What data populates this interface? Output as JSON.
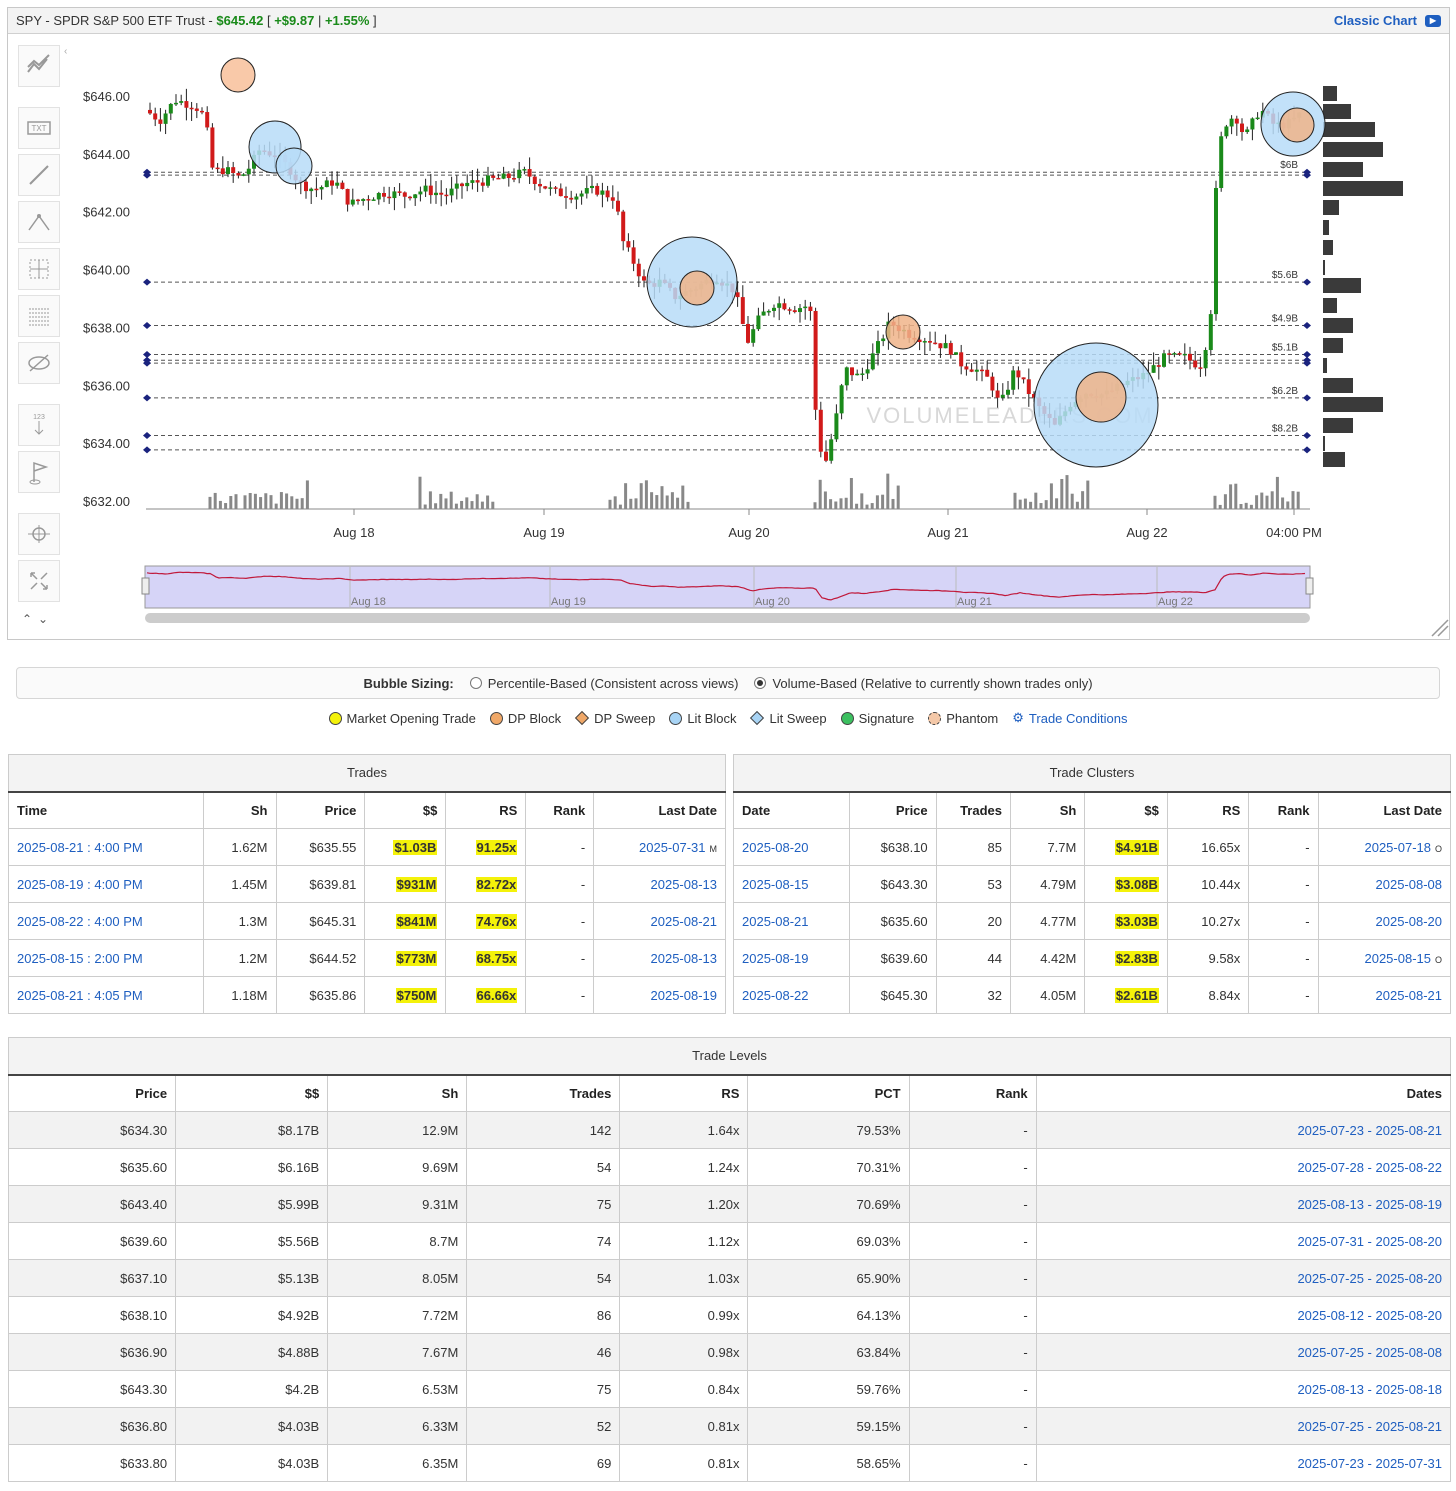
{
  "header": {
    "ticker": "SPY - SPDR S&P 500 ETF Trust - ",
    "price": "$645.42",
    "change_open": " [ ",
    "change": "+$9.87",
    "sep": " | ",
    "pct": "+1.55%",
    "close": " ]",
    "classic_chart": "Classic Chart"
  },
  "toolbar": [
    "trend-icon",
    "text-icon",
    "line-icon",
    "fib-icon",
    "crosshair-box-icon",
    "grid-lines-icon",
    "hide-icon",
    "measure-icon",
    "flag-icon",
    "target-icon",
    "expand-icon"
  ],
  "chart_data": {
    "type": "candlestick",
    "y_ticks": [
      "$646.00",
      "$644.00",
      "$642.00",
      "$640.00",
      "$638.00",
      "$636.00",
      "$634.00",
      "$632.00"
    ],
    "x_ticks": [
      "Aug 18",
      "Aug 19",
      "Aug 20",
      "Aug 21",
      "Aug 22",
      "04:00 PM"
    ],
    "navigator_ticks": [
      "Aug 18",
      "Aug 19",
      "Aug 20",
      "Aug 21",
      "Aug 22"
    ],
    "ylim": [
      632,
      647
    ],
    "levels": [
      {
        "price": 643.4,
        "label": "$6B"
      },
      {
        "price": 643.3,
        "label": ""
      },
      {
        "price": 639.6,
        "label": "$5.6B"
      },
      {
        "price": 638.1,
        "label": "$4.9B"
      },
      {
        "price": 637.1,
        "label": "$5.1B"
      },
      {
        "price": 636.9,
        "label": ""
      },
      {
        "price": 636.8,
        "label": ""
      },
      {
        "price": 635.6,
        "label": "$6.2B"
      },
      {
        "price": 634.3,
        "label": "$8.2B"
      },
      {
        "price": 633.8,
        "label": ""
      }
    ],
    "watermark": "VOLUMELEADERS.COM"
  },
  "bubble_sizing": {
    "label": "Bubble Sizing:",
    "opt1": "Percentile-Based (Consistent across views)",
    "opt2": "Volume-Based (Relative to currently shown trades only)"
  },
  "legend": {
    "l1": "Market Opening Trade",
    "l2": "DP Block",
    "l3": "DP Sweep",
    "l4": "Lit Block",
    "l5": "Lit Sweep",
    "l6": "Signature",
    "l7": "Phantom",
    "l8": "Trade Conditions",
    "c1": "#f4f20a",
    "c2": "#f0a868",
    "c3": "#f0a868",
    "c4": "#a8d4f5",
    "c5": "#a8d4f5",
    "c6": "#3cc060",
    "c7": "#f4c8a8"
  },
  "trades": {
    "title": "Trades",
    "headers": [
      "Time",
      "Sh",
      "Price",
      "$$",
      "RS",
      "Rank",
      "Last Date"
    ],
    "rows": [
      [
        "2025-08-21 : 4:00 PM",
        "1.62M",
        "$635.55",
        "$1.03B",
        "91.25x",
        "-",
        "2025-07-31",
        "M"
      ],
      [
        "2025-08-19 : 4:00 PM",
        "1.45M",
        "$639.81",
        "$931M",
        "82.72x",
        "-",
        "2025-08-13",
        ""
      ],
      [
        "2025-08-22 : 4:00 PM",
        "1.3M",
        "$645.31",
        "$841M",
        "74.76x",
        "-",
        "2025-08-21",
        ""
      ],
      [
        "2025-08-15 : 2:00 PM",
        "1.2M",
        "$644.52",
        "$773M",
        "68.75x",
        "-",
        "2025-08-13",
        ""
      ],
      [
        "2025-08-21 : 4:05 PM",
        "1.18M",
        "$635.86",
        "$750M",
        "66.66x",
        "-",
        "2025-08-19",
        ""
      ]
    ]
  },
  "clusters": {
    "title": "Trade Clusters",
    "headers": [
      "Date",
      "Price",
      "Trades",
      "Sh",
      "$$",
      "RS",
      "Rank",
      "Last Date"
    ],
    "rows": [
      [
        "2025-08-20",
        "$638.10",
        "85",
        "7.7M",
        "$4.91B",
        "16.65x",
        "-",
        "2025-07-18",
        "O"
      ],
      [
        "2025-08-15",
        "$643.30",
        "53",
        "4.79M",
        "$3.08B",
        "10.44x",
        "-",
        "2025-08-08",
        ""
      ],
      [
        "2025-08-21",
        "$635.60",
        "20",
        "4.77M",
        "$3.03B",
        "10.27x",
        "-",
        "2025-08-20",
        ""
      ],
      [
        "2025-08-19",
        "$639.60",
        "44",
        "4.42M",
        "$2.83B",
        "9.58x",
        "-",
        "2025-08-15",
        "O"
      ],
      [
        "2025-08-22",
        "$645.30",
        "32",
        "4.05M",
        "$2.61B",
        "8.84x",
        "-",
        "2025-08-21",
        ""
      ]
    ]
  },
  "levels": {
    "title": "Trade Levels",
    "headers": [
      "Price",
      "$$",
      "Sh",
      "Trades",
      "RS",
      "PCT",
      "Rank",
      "Dates"
    ],
    "rows": [
      [
        "$634.30",
        "$8.17B",
        "12.9M",
        "142",
        "1.64x",
        "79.53%",
        "-",
        "2025-07-23 - 2025-08-21"
      ],
      [
        "$635.60",
        "$6.16B",
        "9.69M",
        "54",
        "1.24x",
        "70.31%",
        "-",
        "2025-07-28 - 2025-08-22"
      ],
      [
        "$643.40",
        "$5.99B",
        "9.31M",
        "75",
        "1.20x",
        "70.69%",
        "-",
        "2025-08-13 - 2025-08-19"
      ],
      [
        "$639.60",
        "$5.56B",
        "8.7M",
        "74",
        "1.12x",
        "69.03%",
        "-",
        "2025-07-31 - 2025-08-20"
      ],
      [
        "$637.10",
        "$5.13B",
        "8.05M",
        "54",
        "1.03x",
        "65.90%",
        "-",
        "2025-07-25 - 2025-08-20"
      ],
      [
        "$638.10",
        "$4.92B",
        "7.72M",
        "86",
        "0.99x",
        "64.13%",
        "-",
        "2025-08-12 - 2025-08-20"
      ],
      [
        "$636.90",
        "$4.88B",
        "7.67M",
        "46",
        "0.98x",
        "63.84%",
        "-",
        "2025-07-25 - 2025-08-08"
      ],
      [
        "$643.30",
        "$4.2B",
        "6.53M",
        "75",
        "0.84x",
        "59.76%",
        "-",
        "2025-08-13 - 2025-08-18"
      ],
      [
        "$636.80",
        "$4.03B",
        "6.33M",
        "52",
        "0.81x",
        "59.15%",
        "-",
        "2025-07-25 - 2025-08-21"
      ],
      [
        "$633.80",
        "$4.03B",
        "6.35M",
        "69",
        "0.81x",
        "58.65%",
        "-",
        "2025-07-23 - 2025-07-31"
      ]
    ]
  }
}
